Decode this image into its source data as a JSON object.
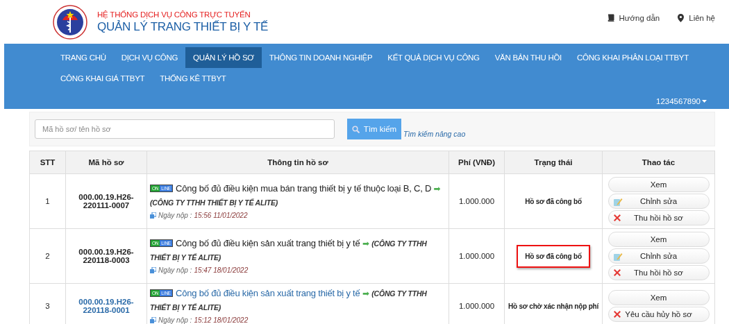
{
  "header": {
    "subtitle": "HỆ THỐNG DỊCH VỤ CÔNG TRỰC TUYẾN",
    "title": "QUẢN LÝ TRANG THIẾT BỊ Y TẾ",
    "links": [
      {
        "kind": "guide",
        "label": "Hướng dẫn"
      },
      {
        "kind": "contact",
        "label": "Liên hệ"
      }
    ]
  },
  "nav": {
    "items": [
      {
        "label": "TRANG CHỦ",
        "selected": false
      },
      {
        "label": "DỊCH VỤ CÔNG",
        "selected": false
      },
      {
        "label": "QUẢN LÝ HỒ SƠ",
        "selected": true
      },
      {
        "label": "THÔNG TIN DOANH NGHIỆP",
        "selected": false
      },
      {
        "label": "KẾT QUẢ DỊCH VỤ CÔNG",
        "selected": false
      },
      {
        "label": "VĂN BẢN THU HỒI",
        "selected": false
      },
      {
        "label": "CÔNG KHAI PHÂN LOẠI TTBYT",
        "selected": false
      },
      {
        "label": "CÔNG KHAI GIÁ TTBYT",
        "selected": false
      },
      {
        "label": "THỐNG KÊ TTBYT",
        "selected": false
      }
    ],
    "user": "1234567890"
  },
  "search": {
    "placeholder": "Mã hồ sơ/ tên hồ sơ",
    "button": "Tìm kiếm",
    "advanced": "Tìm kiếm nâng cao"
  },
  "table": {
    "columns": [
      "STT",
      "Mã hồ sơ",
      "Thông tin hồ sơ",
      "Phí (VNĐ)",
      "Trạng thái",
      "Thao tác"
    ],
    "rows": [
      {
        "stt": "1",
        "code": "000.00.19.H26-220111-0007",
        "unread": false,
        "badge_on": "ON",
        "badge_line": "LINE",
        "title": "Công bố đủ điều kiện mua bán trang thiết bị y tế thuộc loại B, C, D",
        "arrow": "➡",
        "company": "(CÔNG TY TTHH THIẾT BỊ Y TẾ ALITE)",
        "date_label": "Ngày nộp :",
        "date": "15:56 11/01/2022",
        "fee": "1.000.000",
        "status": "Hồ sơ đã công bố",
        "highlighted": false,
        "actions": [
          {
            "kind": "view",
            "label": "Xem"
          },
          {
            "kind": "edit",
            "label": "Chỉnh sửa"
          },
          {
            "kind": "remove",
            "label": "Thu hồi hồ sơ"
          }
        ]
      },
      {
        "stt": "2",
        "code": "000.00.19.H26-220118-0003",
        "unread": false,
        "badge_on": "ON",
        "badge_line": "LINE",
        "title": "Công bố đủ điều kiện sản xuất trang thiết bị y tế",
        "arrow": "➡",
        "company": "(CÔNG TY TTHH THIẾT BỊ Y TẾ ALITE)",
        "date_label": "Ngày nộp :",
        "date": "15:47 18/01/2022",
        "fee": "1.000.000",
        "status": "Hồ sơ đã công bố",
        "highlighted": true,
        "actions": [
          {
            "kind": "view",
            "label": "Xem"
          },
          {
            "kind": "edit",
            "label": "Chỉnh sửa"
          },
          {
            "kind": "remove",
            "label": "Thu hồi hồ sơ"
          }
        ]
      },
      {
        "stt": "3",
        "code": "000.00.19.H26-220118-0001",
        "unread": true,
        "badge_on": "ON",
        "badge_line": "LINE",
        "title": "Công bố đủ điều kiện sản xuất trang thiết bị y tế",
        "arrow": "➡",
        "company": "(CÔNG TY TTHH THIẾT BỊ Y TẾ ALITE)",
        "date_label": "Ngày nộp :",
        "date": "15:12 18/01/2022",
        "fee": "1.000.000",
        "status": "Hồ sơ chờ xác nhận nộp phí",
        "highlighted": false,
        "actions": [
          {
            "kind": "view",
            "label": "Xem"
          },
          {
            "kind": "remove",
            "label": "Yêu cầu hủy hồ sơ"
          }
        ]
      }
    ]
  }
}
